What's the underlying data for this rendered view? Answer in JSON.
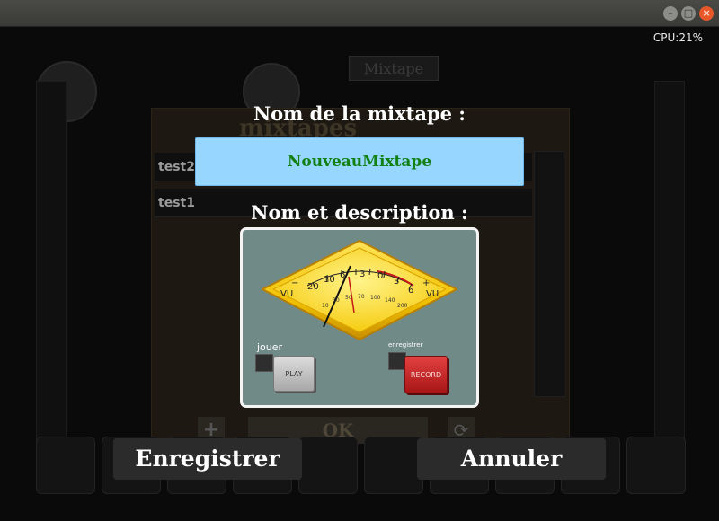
{
  "window": {
    "minimize_glyph": "–",
    "maximize_glyph": "□",
    "close_glyph": "×"
  },
  "status": {
    "cpu": "CPU:21%"
  },
  "background": {
    "tab": "Mixtape",
    "panel_title": "mixtapes",
    "rows": [
      "test2",
      "test1"
    ],
    "plus_label": "+",
    "ok_label": "OK",
    "refresh_glyph": "⟳"
  },
  "dialog": {
    "name_label": "Nom de la mixtape :",
    "name_value": "NouveauMixtape",
    "desc_label": "Nom et description :",
    "preview": {
      "vu_left": "VU",
      "vu_right": "VU",
      "minus": "−",
      "plus": "+",
      "top_scale": [
        "20",
        "10",
        "6",
        "3",
        "0",
        "3",
        "6"
      ],
      "bottom_scale": [
        "10",
        "30",
        "50",
        "70",
        "100",
        "140",
        "200"
      ],
      "play_caption": "jouer",
      "play_label": "PLAY",
      "record_caption": "enregistrer",
      "record_label": "RECORD"
    },
    "save_button": "Enregistrer",
    "cancel_button": "Annuler"
  },
  "colors": {
    "input_bg": "#96d6ff",
    "input_text": "#128012",
    "meter_yellow": "#f2c200",
    "record_red": "#c62020"
  }
}
